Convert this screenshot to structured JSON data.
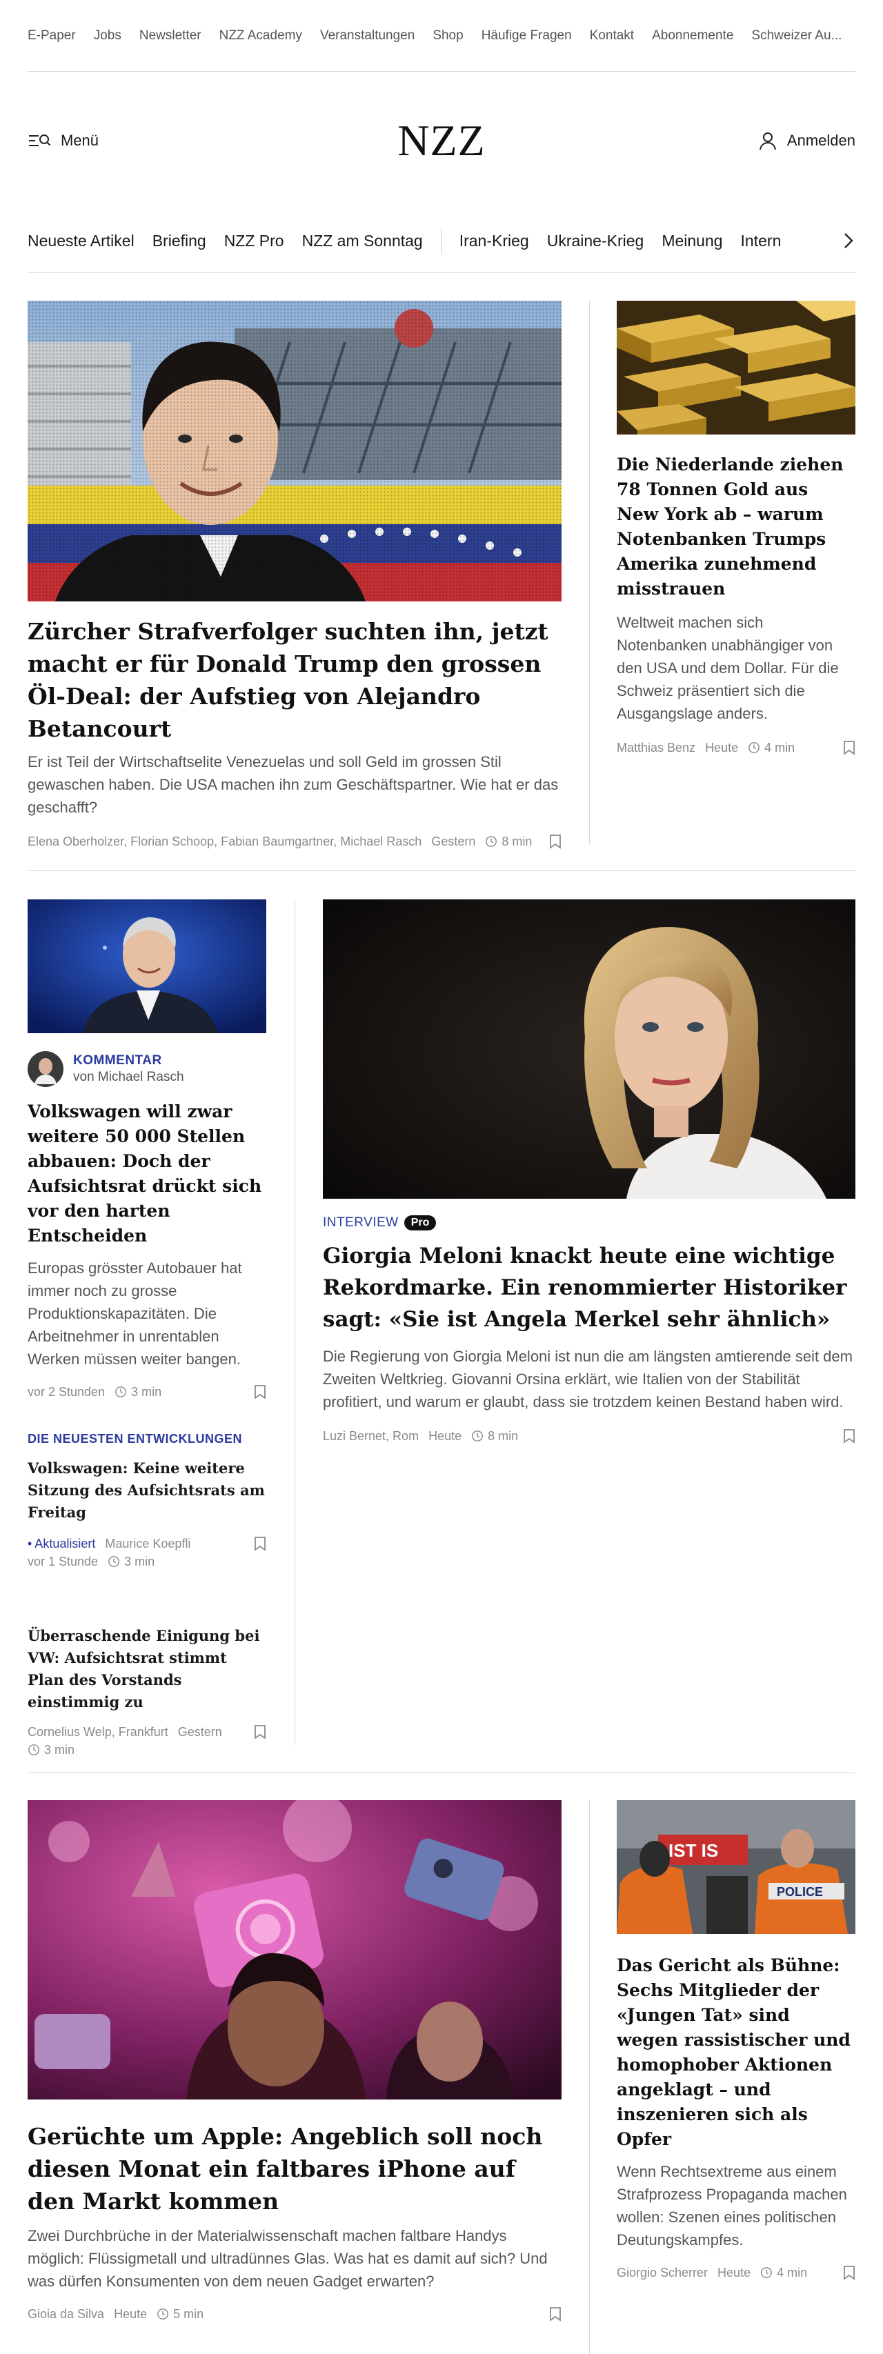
{
  "topnav": [
    "E-Paper",
    "Jobs",
    "Newsletter",
    "NZZ Academy",
    "Veranstaltungen",
    "Shop",
    "Häufige Fragen",
    "Kontakt",
    "Abonnemente",
    "Schweizer Au..."
  ],
  "header": {
    "menu_label": "Menü",
    "logo": "NZZ",
    "login_label": "Anmelden"
  },
  "secnav": {
    "left": [
      "Neueste Artikel",
      "Briefing",
      "NZZ Pro",
      "NZZ am Sonntag"
    ],
    "right": [
      "Iran-Krieg",
      "Ukraine-Krieg",
      "Meinung",
      "Intern"
    ]
  },
  "articles": {
    "betancourt": {
      "title": "Zürcher Strafverfolger suchten ihn, jetzt macht er für Donald Trump den grossen Öl-Deal: der Aufstieg von Alejandro Betancourt",
      "lead": "Er ist Teil der Wirtschaftselite Venezuelas und soll Geld im grossen Stil gewaschen haben. Die USA machen ihn zum Geschäftspartner. Wie hat er das geschafft?",
      "authors": "Elena Oberholzer, Florian Schoop, Fabian Baumgartner, Michael Rasch",
      "date": "Gestern",
      "time": "8 min"
    },
    "gold": {
      "title": "Die Niederlande ziehen 78 Tonnen Gold aus New York ab – warum Notenbanken Trumps Amerika zunehmend misstrauen",
      "lead": "Weltweit machen sich Notenbanken unabhängiger von den USA und dem Dollar. Für die Schweiz präsentiert sich die Ausgangslage anders.",
      "authors": "Matthias Benz",
      "date": "Heute",
      "time": "4 min"
    },
    "vw": {
      "kicker": "KOMMENTAR",
      "byline": "von Michael Rasch",
      "title": "Volkswagen will zwar weitere 50 000 Stellen abbauen: Doch der Aufsichtsrat drückt sich vor den harten Entscheiden",
      "lead": "Europas grösster Autobauer hat immer noch zu grosse Produktionskapazitäten. Die Arbeitnehmer in unrentablen Werken müssen weiter bangen.",
      "date": "vor 2 Stunden",
      "time": "3 min"
    },
    "latest": {
      "kicker": "DIE NEUESTEN ENTWICKLUNGEN",
      "title": "Volkswagen: Keine weitere Sitzung des Aufsichtsrats am Freitag",
      "updated": "• Aktualisiert",
      "authors": "Maurice Koepfli",
      "date": "vor 1 Stunde",
      "time": "3 min"
    },
    "vw2": {
      "title": "Überraschende Einigung bei VW: Aufsichtsrat stimmt Plan des Vorstands einstimmig zu",
      "authors": "Cornelius Welp, Frankfurt",
      "date": "Gestern",
      "time": "3 min"
    },
    "meloni": {
      "kicker": "INTERVIEW",
      "badge": "Pro",
      "title": "Giorgia Meloni knackt heute eine wichtige Rekordmarke. Ein renommierter Historiker sagt: «Sie ist Angela Merkel sehr ähnlich»",
      "lead": "Die Regierung von Giorgia Meloni ist nun die am längsten amtierende seit dem Zweiten Weltkrieg. Giovanni Orsina erklärt, wie Italien von der Stabilität profitiert, und warum er glaubt, dass sie trotzdem keinen Bestand haben wird.",
      "authors": "Luzi Bernet, Rom",
      "date": "Heute",
      "time": "8 min"
    },
    "apple": {
      "title": "Gerüchte um Apple: Angeblich soll noch diesen Monat ein faltbares iPhone auf den Markt kommen",
      "lead": "Zwei Durchbrüche in der Materialwissenschaft machen faltbare Handys möglich: Flüssigmetall und ultradünnes Glas. Was hat es damit auf sich? Und was dürfen Konsumenten von dem neuen Gadget erwarten?",
      "authors": "Gioia da Silva",
      "date": "Heute",
      "time": "5 min"
    },
    "court": {
      "title": "Das Gericht als Bühne: Sechs Mitglieder der «Jungen Tat» sind wegen rassistischer und homophober Aktionen angeklagt – und inszenieren sich als Opfer",
      "lead": "Wenn Rechtsextreme aus einem Strafprozess Propaganda machen wollen: Szenen eines politischen Deutungskampfes.",
      "authors": "Giorgio Scherrer",
      "date": "Heute",
      "time": "4 min"
    }
  },
  "image_text": {
    "court_banner": "IST IS",
    "police": "POLICE"
  }
}
